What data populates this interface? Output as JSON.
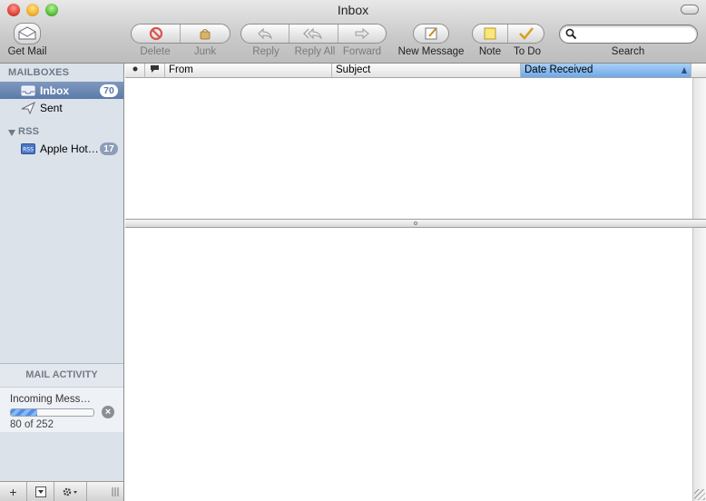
{
  "window": {
    "title": "Inbox"
  },
  "toolbar": {
    "get_mail": "Get Mail",
    "delete": "Delete",
    "junk": "Junk",
    "reply": "Reply",
    "reply_all": "Reply All",
    "forward": "Forward",
    "new_message": "New Message",
    "note": "Note",
    "todo": "To Do",
    "search_label": "Search",
    "search_value": ""
  },
  "sidebar": {
    "mailboxes_header": "MAILBOXES",
    "items": [
      {
        "label": "Inbox",
        "badge": "70",
        "selected": true,
        "icon": "inbox-icon"
      },
      {
        "label": "Sent",
        "badge": "",
        "selected": false,
        "icon": "sent-icon"
      }
    ],
    "rss_header": "RSS",
    "rss_items": [
      {
        "label": "Apple Hot…",
        "badge": "17",
        "icon": "rss-icon"
      }
    ]
  },
  "activity": {
    "header": "MAIL ACTIVITY",
    "title": "Incoming Mess…",
    "count_text": "80 of 252",
    "progress_fraction": 0.32
  },
  "list": {
    "columns": {
      "from": "From",
      "subject": "Subject",
      "date_received": "Date Received"
    },
    "sorted_column": "date_received"
  },
  "colors": {
    "selection": "#5c7aa8",
    "sorted_column": "#6fa8e8",
    "sidebar_bg": "#dbe2ea"
  }
}
